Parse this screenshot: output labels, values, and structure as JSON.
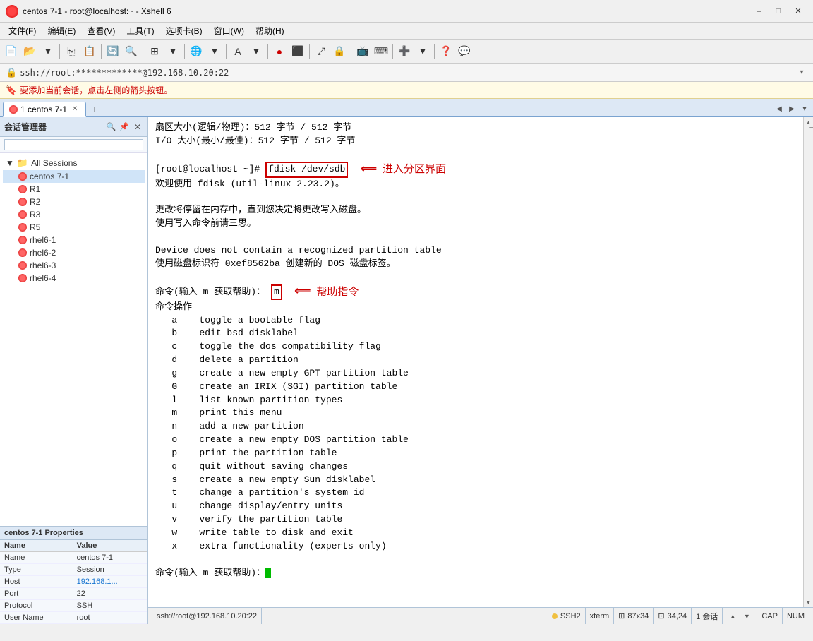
{
  "titleBar": {
    "title": "centos 7-1 - root@localhost:~ - Xshell 6",
    "appIconColor": "#cc0000"
  },
  "menuBar": {
    "items": [
      "文件(F)",
      "编辑(E)",
      "查看(V)",
      "工具(T)",
      "选项卡(B)",
      "窗口(W)",
      "帮助(H)"
    ]
  },
  "addressBar": {
    "text": "ssh://root:*************@192.168.10.20:22"
  },
  "infoBar": {
    "text": "要添加当前会话，点击左侧的箭头按钮。"
  },
  "tabs": [
    {
      "label": "1 centos 7-1",
      "active": true
    },
    {
      "label": "+",
      "active": false
    }
  ],
  "sidebar": {
    "title": "会话管理器",
    "sessions": {
      "groupLabel": "All Sessions",
      "items": [
        "centos 7-1",
        "R1",
        "R2",
        "R3",
        "R5",
        "rhel6-1",
        "rhel6-2",
        "rhel6-3",
        "rhel6-4"
      ]
    }
  },
  "properties": {
    "title": "centos 7-1 Properties",
    "columns": [
      "Name",
      "Value"
    ],
    "rows": [
      {
        "name": "Name",
        "value": "centos 7-1",
        "isLink": false
      },
      {
        "name": "Type",
        "value": "Session",
        "isLink": false
      },
      {
        "name": "Host",
        "value": "192.168.1...",
        "isLink": true
      },
      {
        "name": "Port",
        "value": "22",
        "isLink": false
      },
      {
        "name": "Protocol",
        "value": "SSH",
        "isLink": false
      },
      {
        "name": "User Name",
        "value": "root",
        "isLink": false
      }
    ]
  },
  "terminal": {
    "lines": [
      "扇区大小(逻辑/物理)：512 字节 / 512 字节",
      "I/O 大小(最小/最佳)：512 字节 / 512 字节",
      "",
      "[root@localhost ~]# fdisk /dev/sdb",
      "欢迎使用 fdisk (util-linux 2.23.2)。",
      "",
      "更改将停留在内存中，直到您决定将更改写入磁盘。",
      "使用写入命令前请三思。",
      "",
      "Device does not contain a recognized partition table",
      "使用磁盘标识符 0xef8562ba 创建新的 DOS 磁盘标签。",
      "",
      "命令(输入 m 获取帮助)：m",
      "命令操作",
      "   a   toggle a bootable flag",
      "   b   edit bsd disklabel",
      "   c   toggle the dos compatibility flag",
      "   d   delete a partition",
      "   g   create a new empty GPT partition table",
      "   G   create an IRIX (SGI) partition table",
      "   l   list known partition types",
      "   m   print this menu",
      "   n   add a new partition",
      "   o   create a new empty DOS partition table",
      "   p   print the partition table",
      "   q   quit without saving changes",
      "   s   create a new empty Sun disklabel",
      "   t   change a partition's system id",
      "   u   change display/entry units",
      "   v   verify the partition table",
      "   w   write table to disk and exit",
      "   x   extra functionality (experts only)",
      "",
      "命令(输入 m 获取帮助)："
    ],
    "annotation1": {
      "text": "进入分区界面",
      "line": 3
    },
    "annotation2": {
      "text": "帮助指令",
      "line": 12
    }
  },
  "statusBar": {
    "address": "ssh://root@192.168.10.20:22",
    "protocol": "SSH2",
    "encoding": "xterm",
    "size": "87x34",
    "position": "34,24",
    "sessions": "1 会话",
    "cap": "CAP",
    "num": "NUM"
  }
}
